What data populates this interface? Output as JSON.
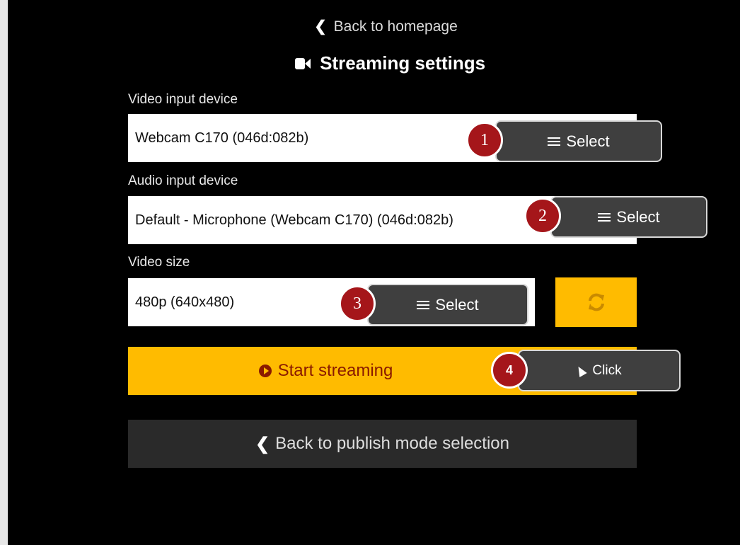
{
  "header": {
    "back_home_label": "Back to homepage",
    "title": "Streaming settings"
  },
  "form": {
    "video_input": {
      "label": "Video input device",
      "value": "Webcam C170 (046d:082b)"
    },
    "audio_input": {
      "label": "Audio input device",
      "value": "Default - Microphone (Webcam C170) (046d:082b)"
    },
    "video_size": {
      "label": "Video size",
      "value": "480p (640x480)"
    }
  },
  "annotations": {
    "select_label": "Select",
    "click_label": "Click",
    "steps": [
      "1",
      "2",
      "3",
      "4"
    ]
  },
  "actions": {
    "start_streaming": "Start streaming",
    "back_to_publish": "Back to publish mode selection"
  },
  "colors": {
    "accent": "#ffbb00",
    "start_text": "#8a1a00",
    "badge": "#a5161a",
    "background": "#000000"
  },
  "icons": {
    "camera": "video-camera-icon",
    "chevron": "chevron-left-icon",
    "refresh": "refresh-icon",
    "play": "play-circle-icon",
    "menu": "hamburger-icon",
    "cursor": "mouse-pointer-icon"
  }
}
